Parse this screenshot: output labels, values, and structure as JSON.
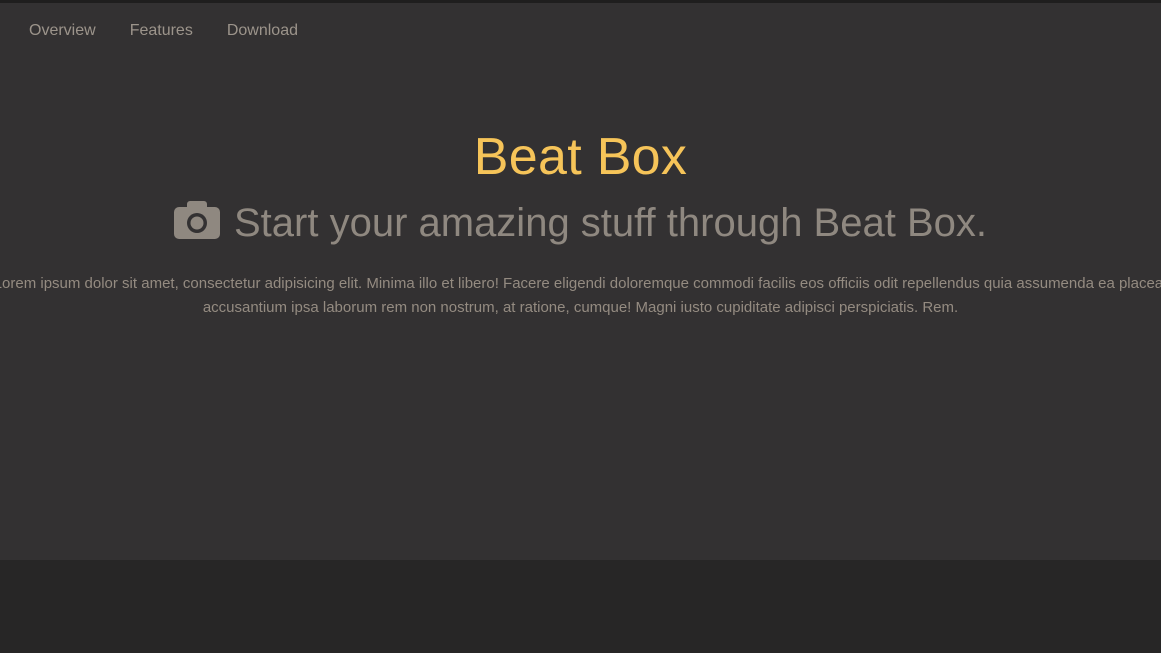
{
  "nav": {
    "items": [
      {
        "label": "Overview"
      },
      {
        "label": "Features"
      },
      {
        "label": "Download"
      }
    ]
  },
  "hero": {
    "title": "Beat Box",
    "subtitle": "Start your amazing stuff through Beat Box.",
    "subtitle_icon": "camera-icon",
    "body": "Lorem ipsum dolor sit amet, consectetur adipisicing elit. Minima illo et libero! Facere eligendi doloremque commodi facilis eos officiis odit repellendus quia assumenda ea placeat accusantium ipsa laborum rem non nostrum, at ratione, cumque! Magni iusto cupiditate adipisci perspiciatis. Rem."
  },
  "colors": {
    "hero_background": "#333132",
    "page_background": "#272626",
    "title": "#f6c459",
    "subtitle": "#8f8880",
    "nav_text": "#9c948b",
    "body_text": "#948b81"
  }
}
